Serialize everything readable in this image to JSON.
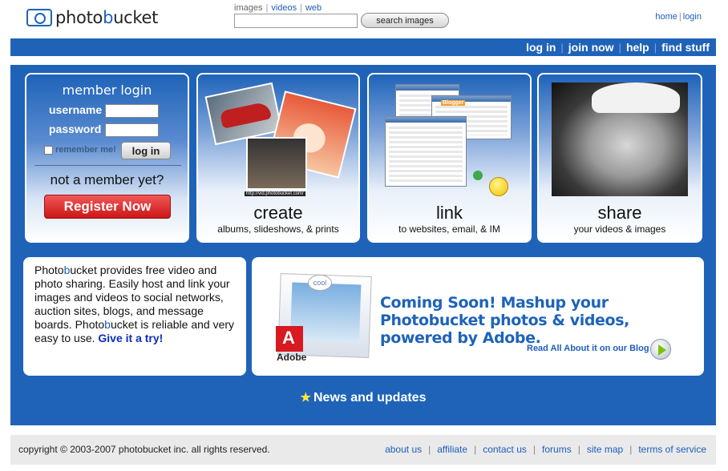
{
  "header": {
    "logo": {
      "pre": "photo",
      "highlight": "b",
      "post": "ucket"
    },
    "search_tabs": {
      "images": "images",
      "videos": "videos",
      "web": "web"
    },
    "search_value": "",
    "search_button": "search images",
    "links": {
      "home": "home",
      "login": "login"
    }
  },
  "nav": {
    "login": "log in",
    "join": "join now",
    "help": "help",
    "find": "find stuff"
  },
  "login": {
    "title": "member login",
    "username_label": "username",
    "password_label": "password",
    "username_value": "",
    "password_value": "",
    "remember": "remember me!",
    "login_button": "log in",
    "not_member": "not a member yet?",
    "register_button": "Register Now"
  },
  "panels": {
    "create": {
      "heading": "create",
      "sub": "albums, slideshows, & prints",
      "url_caption": "http://vid.photobucket.com/"
    },
    "link": {
      "heading": "link",
      "sub": "to websites, email, & IM",
      "blogger": "Blogger"
    },
    "share": {
      "heading": "share",
      "sub": "your videos & images"
    }
  },
  "description": {
    "p1": "Photo",
    "p1b": "b",
    "p2": "ucket provides free video and photo sharing. Easily host and link your images and videos to social networks, auction sites, blogs, and message boards. Photo",
    "p2b": "b",
    "p3": "ucket is reliable and very easy to use. ",
    "link": "Give it a try!"
  },
  "adobe": {
    "headline": "Coming Soon! Mashup your Photobucket photos & videos, powered by Adobe.",
    "blog_link": "Read All About it on our Blog",
    "cool": "cool",
    "brand": "Adobe"
  },
  "news": {
    "title": "News and updates"
  },
  "footer": {
    "copyright": "copyright © 2003-2007 photobucket inc. all rights reserved.",
    "links": [
      "about us",
      "affiliate",
      "contact us",
      "forums",
      "site map",
      "terms of service"
    ]
  },
  "colors": {
    "brand_blue": "#1f63b9",
    "link_blue": "#1e5dbb",
    "register_red": "#d9272a"
  },
  "icons": [
    "logo-icon",
    "star-icon",
    "arrow-right-icon",
    "smiley-icon",
    "adobe-logo"
  ]
}
